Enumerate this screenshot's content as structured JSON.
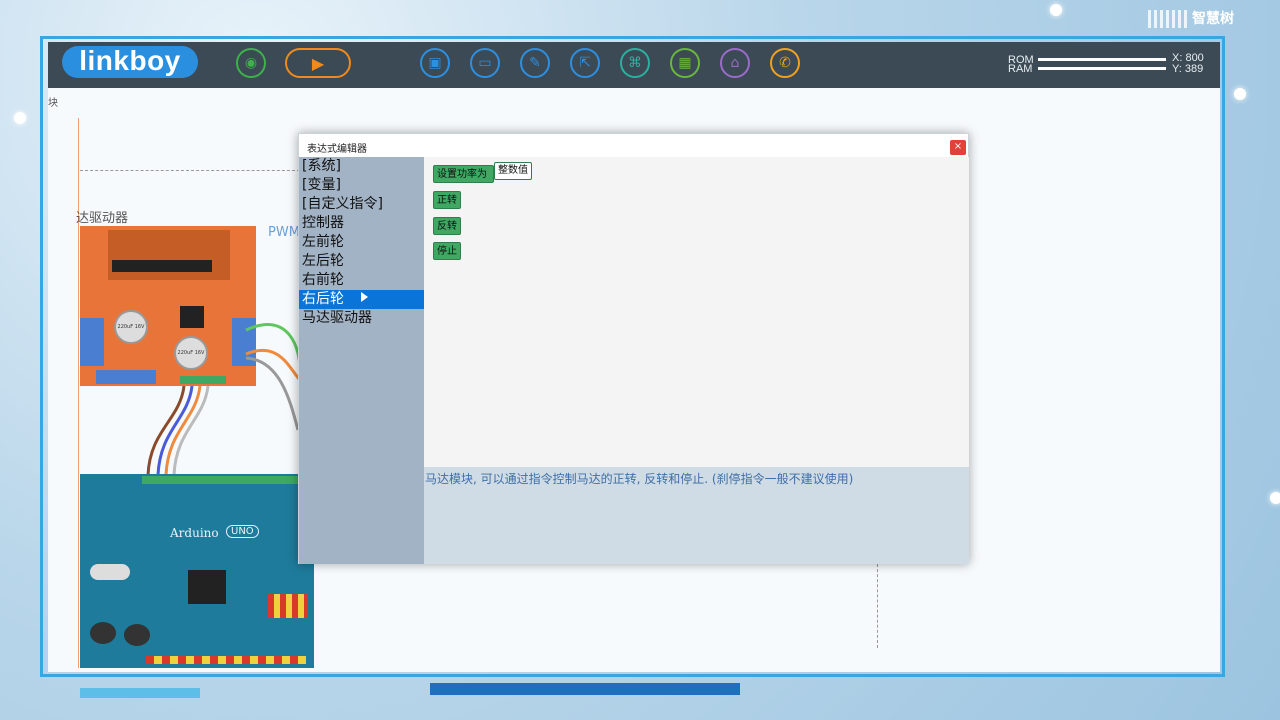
{
  "toolbar": {
    "logo": "linkboy",
    "ram_label": "RAM",
    "rom_label": "ROM",
    "x_readout": "X: 800",
    "y_readout": "Y: 389"
  },
  "watermark": "智慧树",
  "canvas": {
    "partial_label": "块",
    "driver_label": "达驱动器",
    "pwm_label": "PWM",
    "arduino_label": "Arduino",
    "uno_label": "UNO",
    "cap1": "220uF 16V",
    "cap2": "220uF 16V"
  },
  "dialog": {
    "title": "表达式编辑器",
    "close": "×",
    "categories": [
      "[系统]",
      "[变量]",
      "[自定义指令]",
      "控制器",
      "左前轮",
      "左后轮",
      "右前轮",
      "右后轮",
      "马达驱动器"
    ],
    "selected_index": 7,
    "commands": {
      "set_power": "设置功率为",
      "set_power_value": "整数值",
      "forward": "正转",
      "reverse": "反转",
      "stop": "停止"
    },
    "description": "马达模块, 可以通过指令控制马达的正转, 反转和停止. (刹停指令一般不建议使用)"
  },
  "colors": {
    "accent": "#0a74d9",
    "command_green": "#3fa862",
    "toolbar": "#3b4a55"
  }
}
